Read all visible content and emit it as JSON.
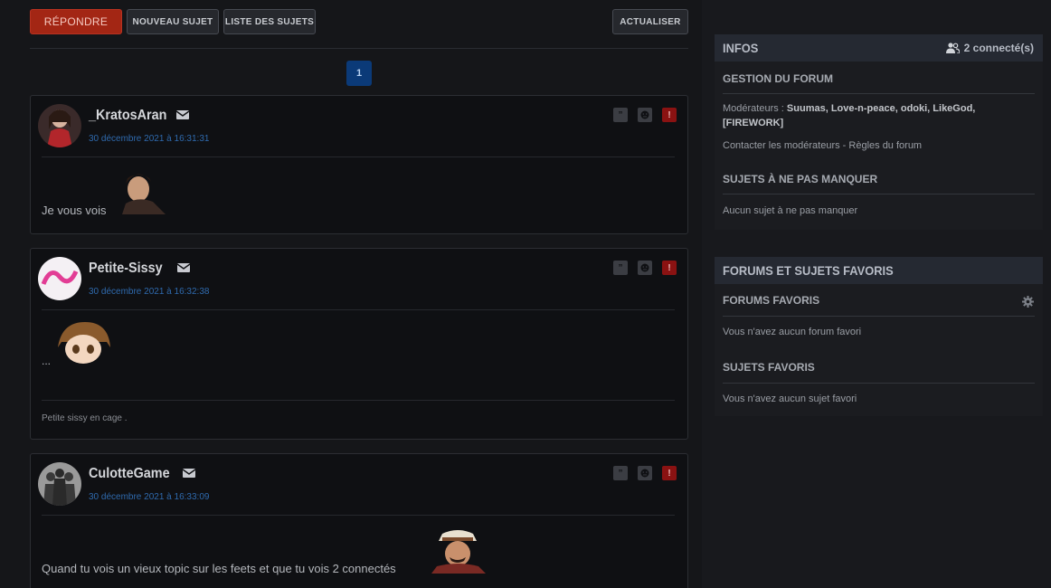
{
  "toolbar": {
    "reply_label": "Répondre",
    "new_topic_label": "Nouveau sujet",
    "topic_list_label": "Liste des sujets",
    "refresh_label": "Actualiser"
  },
  "pagination": {
    "current": "1"
  },
  "posts": [
    {
      "author": "_KratosAran",
      "date": "30 décembre 2021 à 16:31:31",
      "text": "Je vous vois",
      "signature": ""
    },
    {
      "author": "Petite-Sissy",
      "date": "30 décembre 2021 à 16:32:38",
      "text": "...",
      "signature": "Petite sissy en cage ."
    },
    {
      "author": "CulotteGame",
      "date": "30 décembre 2021 à 16:33:09",
      "text": "Quand tu vois un vieux topic sur les feets et que tu vois 2 connectés",
      "signature": ""
    }
  ],
  "sidebar": {
    "infos": {
      "title": "Infos",
      "online": "2 connecté(s)",
      "forum_management_title": "Gestion du forum",
      "moderators_label": "Modérateurs : ",
      "moderators": "Suumas, Love-n-peace, odoki, LikeGod, [FIREWORK]",
      "contact_links": "Contacter les modérateurs - Règles du forum",
      "must_see_title": "Sujets à ne pas manquer",
      "must_see_text": "Aucun sujet à ne pas manquer"
    },
    "favorites": {
      "title": "Forums et sujets favoris",
      "forums_title": "Forums favoris",
      "forums_empty": "Vous n'avez aucun forum favori",
      "topics_title": "Sujets favoris",
      "topics_empty": "Vous n'avez aucun sujet favori"
    }
  },
  "icons": {
    "mail": "mail-icon",
    "quote": "quote-icon",
    "warn": "warning-icon",
    "report": "report-icon",
    "users": "users-icon",
    "gear": "gear-icon"
  },
  "colors": {
    "accent_red": "#a32614",
    "link_blue": "#2f6aae",
    "pager_blue": "#0b3a78"
  }
}
